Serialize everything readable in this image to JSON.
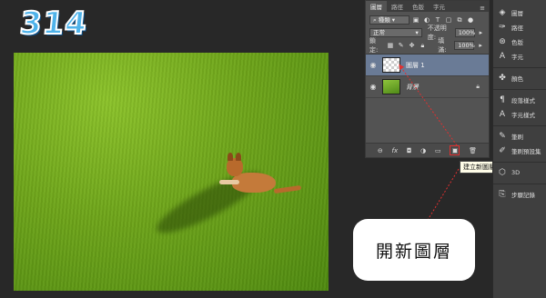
{
  "step_number": "314",
  "layers_panel": {
    "tabs": [
      "圖層",
      "路徑",
      "色版",
      "字元"
    ],
    "menu_icon": "panel-menu-icon",
    "filter_kind": "種類",
    "blend_mode": "正常",
    "opacity_label": "不透明度:",
    "opacity_value": "100%",
    "lock_label": "鎖定:",
    "fill_label": "填滿:",
    "fill_value": "100%",
    "layers": [
      {
        "name": "圖層 1",
        "selected": true
      },
      {
        "name": "背景",
        "selected": false
      }
    ]
  },
  "tooltip": "建立新圖層",
  "callout_text": "開新圖層",
  "right_dock": {
    "group1": [
      "圖層",
      "路徑",
      "色版",
      "字元"
    ],
    "group2": [
      "顏色"
    ],
    "group3": [
      "段落樣式",
      "字元樣式"
    ],
    "group4": [
      "筆刷",
      "筆刷預設集"
    ],
    "group5": [
      "3D"
    ],
    "group6": [
      "步驟記錄"
    ]
  },
  "colors": {
    "annotation_red": "#e03030",
    "selected_layer": "#6a7b96",
    "badge_blue": "#4fb3ea"
  }
}
